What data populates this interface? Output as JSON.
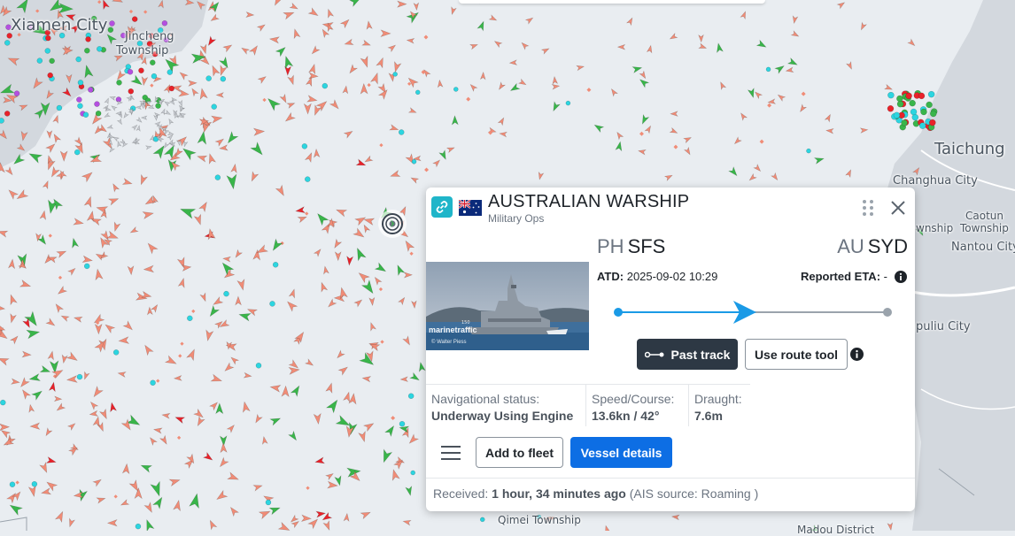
{
  "map": {
    "labels": {
      "xiamen": "Xiamen City",
      "jincheng": "Jincheng",
      "jincheng_sub": "Township",
      "taichung": "Taichung",
      "changhua": "Changhua City",
      "caotun": "Caotun",
      "caotun_sub": "Township",
      "nantou": "Nantou City",
      "wnship": "wnship",
      "puliu": "puliu City",
      "qimei": "Qimei Township",
      "madou": "Madou District"
    },
    "colors": {
      "sea": "#e9edf1",
      "land": "#d3d8de",
      "cargo": "#f08c77",
      "tanker": "#e8222a",
      "passenger": "#39b54a",
      "fishing": "#2cd5e0",
      "pleasure": "#b44fe0",
      "navaid": "#c8ccd2"
    }
  },
  "vessel": {
    "name": "AUSTRALIAN WARSHIP",
    "type": "Military Ops",
    "flag_icon": "australia-flag-icon",
    "photo_watermark": "marinetraffic",
    "photo_credit": "© Walter Piess",
    "from": {
      "country": "PH",
      "port": "SFS"
    },
    "to": {
      "country": "AU",
      "port": "SYD"
    },
    "atd_label": "ATD:",
    "atd_value": "2025-09-02 10:29",
    "eta_label": "Reported ETA:",
    "eta_value": "-",
    "route_progress": 0.48,
    "buttons": {
      "past_track": "Past track",
      "route_tool": "Use route tool",
      "add_fleet": "Add to fleet",
      "details": "Vessel details"
    },
    "stats": {
      "nav_status_label": "Navigational status:",
      "nav_status_value": "Underway Using Engine",
      "speed_label": "Speed/Course:",
      "speed_value": "13.6kn / 42°",
      "draught_label": "Draught:",
      "draught_value": "7.6m"
    },
    "received_label": "Received:",
    "received_value": "1 hour, 34 minutes ago",
    "ais_source": "(AIS source: Roaming )",
    "accent": "#0d6ee4",
    "route_color": "#1a9ae6"
  }
}
